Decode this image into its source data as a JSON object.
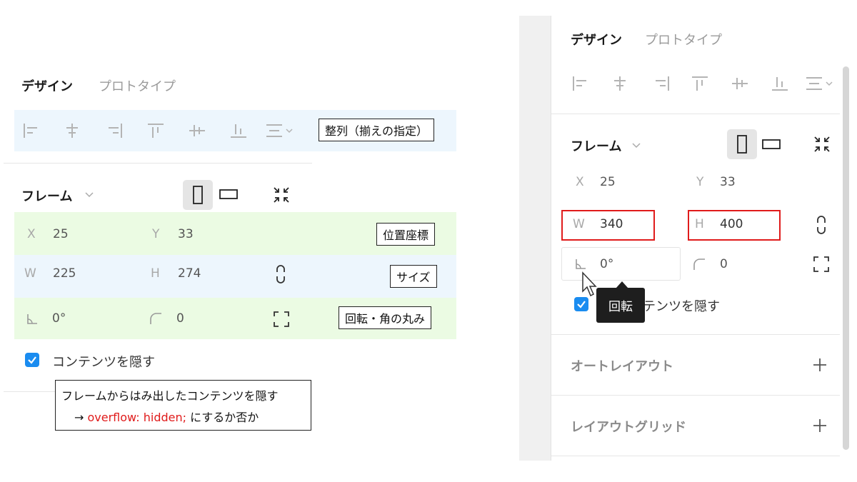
{
  "left": {
    "tabs": {
      "design": "デザイン",
      "prototype": "プロトタイプ"
    },
    "frame_title": "フレーム",
    "x": {
      "label": "X",
      "value": "25"
    },
    "y": {
      "label": "Y",
      "value": "33"
    },
    "w": {
      "label": "W",
      "value": "225"
    },
    "h": {
      "label": "H",
      "value": "274"
    },
    "rotation": "0°",
    "radius": "0",
    "clip_label": "コンテンツを隠す",
    "annotations": {
      "align": "整列（揃えの指定）",
      "position": "位置座標",
      "size": "サイズ",
      "rotate": "回転・角の丸み",
      "clip_line1": "フレームからはみ出したコンテンツを隠す",
      "clip_arrow": "→",
      "clip_code": "overflow: hidden;",
      "clip_line2_tail": "にするか否か"
    }
  },
  "right": {
    "tabs": {
      "design": "デザイン",
      "prototype": "プロトタイプ"
    },
    "frame_title": "フレーム",
    "x": {
      "label": "X",
      "value": "25"
    },
    "y": {
      "label": "Y",
      "value": "33"
    },
    "w": {
      "label": "W",
      "value": "340"
    },
    "h": {
      "label": "H",
      "value": "400"
    },
    "rotation": "0°",
    "radius": "0",
    "tooltip": "回転",
    "clip_label_visible": "ンテンツを隠す",
    "sections": {
      "auto_layout": "オートレイアウト",
      "layout_grid": "レイアウトグリッド"
    },
    "plus": "+"
  },
  "colors": {
    "accent": "#1a8cf0",
    "highlight_red": "#e01b1b",
    "code_red": "#e01b1b"
  }
}
